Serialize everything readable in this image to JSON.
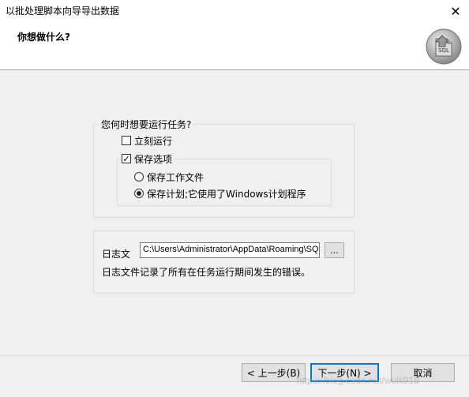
{
  "window": {
    "title": "以批处理脚本向导导出数据",
    "close_glyph": "✕"
  },
  "header": {
    "title": "你想做什么?",
    "icon": "sql-database-icon",
    "icon_label": "SQL"
  },
  "run_group": {
    "legend": "您何时想要运行任务?",
    "run_now": {
      "label": "立刻运行",
      "checked": false
    },
    "save_options": {
      "label": "保存选项",
      "checked": true,
      "check_glyph": "✓",
      "choices": [
        {
          "label": "保存工作文件",
          "selected": false
        },
        {
          "label": "保存计划;它使用了Windows计划程序",
          "selected": true
        }
      ]
    }
  },
  "log_group": {
    "label": "日志文",
    "path_value": "C:\\Users\\Administrator\\AppData\\Roaming\\SQL",
    "browse_label": "...",
    "description": "日志文件记录了所有在任务运行期间发生的错误。"
  },
  "buttons": {
    "back": "< 上一步(B)",
    "next": "下一步(N) >",
    "cancel": "取消"
  },
  "watermark": "https://blog.csdn.net/wolk918"
}
